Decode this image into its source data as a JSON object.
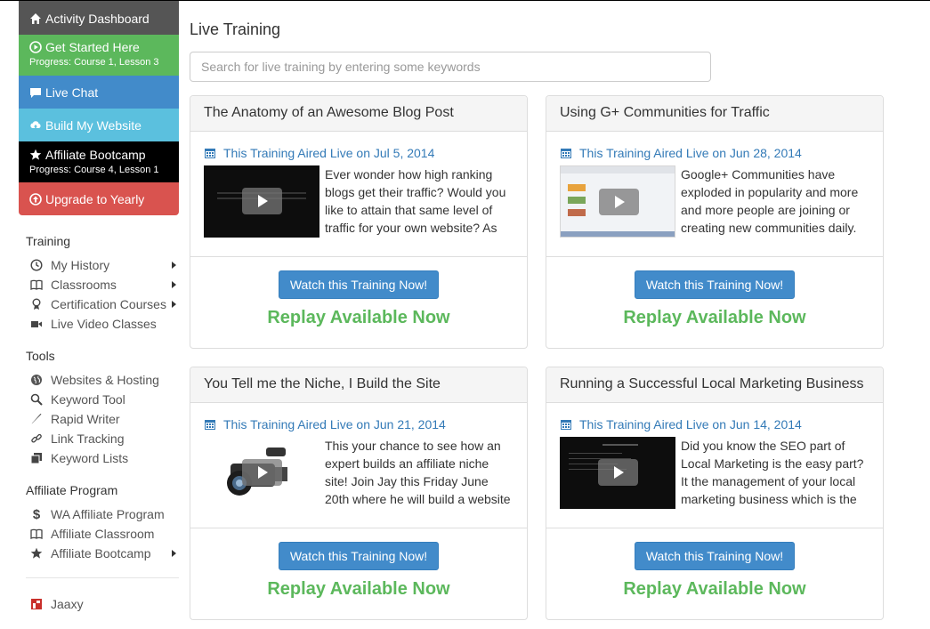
{
  "sidebar": {
    "menu": {
      "dashboard": "Activity Dashboard",
      "get_started": "Get Started Here",
      "get_started_progress": "Progress: Course 1, Lesson 3",
      "live_chat": "Live Chat",
      "build_website": "Build My Website",
      "bootcamp": "Affiliate Bootcamp",
      "bootcamp_progress": "Progress: Course 4, Lesson 1",
      "upgrade": "Upgrade to Yearly"
    },
    "training": {
      "heading": "Training",
      "items": [
        "My History",
        "Classrooms",
        "Certification Courses",
        "Live Video Classes"
      ]
    },
    "tools": {
      "heading": "Tools",
      "items": [
        "Websites & Hosting",
        "Keyword Tool",
        "Rapid Writer",
        "Link Tracking",
        "Keyword Lists"
      ]
    },
    "affiliate": {
      "heading": "Affiliate Program",
      "items": [
        "WA Affiliate Program",
        "Affiliate Classroom",
        "Affiliate Bootcamp"
      ]
    },
    "extra": {
      "jaaxy": "Jaaxy"
    }
  },
  "main": {
    "title": "Live Training",
    "search_placeholder": "Search for live training by entering some keywords",
    "cards": [
      {
        "title": "The Anatomy of an Awesome Blog Post",
        "aired": "This Training Aired Live on Jul 5, 2014",
        "description": "Ever wonder how high ranking blogs get their traffic? Would you like to attain that same level of traffic for your own website? As",
        "button": "Watch this Training Now!",
        "replay": "Replay Available Now"
      },
      {
        "title": "Using G+ Communities for Traffic",
        "aired": "This Training Aired Live on Jun 28, 2014",
        "description": "Google+ Communities have exploded in popularity and more and more people are joining or creating new communities daily.",
        "button": "Watch this Training Now!",
        "replay": "Replay Available Now"
      },
      {
        "title": "You Tell me the Niche, I Build the Site",
        "aired": "This Training Aired Live on Jun 21, 2014",
        "description": "This your chance to see how an expert builds an affiliate niche site! Join Jay this Friday June 20th where he will build a website",
        "button": "Watch this Training Now!",
        "replay": "Replay Available Now"
      },
      {
        "title": "Running a Successful Local Marketing Business",
        "aired": "This Training Aired Live on Jun 14, 2014",
        "description": "Did you know the SEO part of Local Marketing is the easy part? It the management of your local marketing business which is the",
        "button": "Watch this Training Now!",
        "replay": "Replay Available Now"
      }
    ]
  }
}
